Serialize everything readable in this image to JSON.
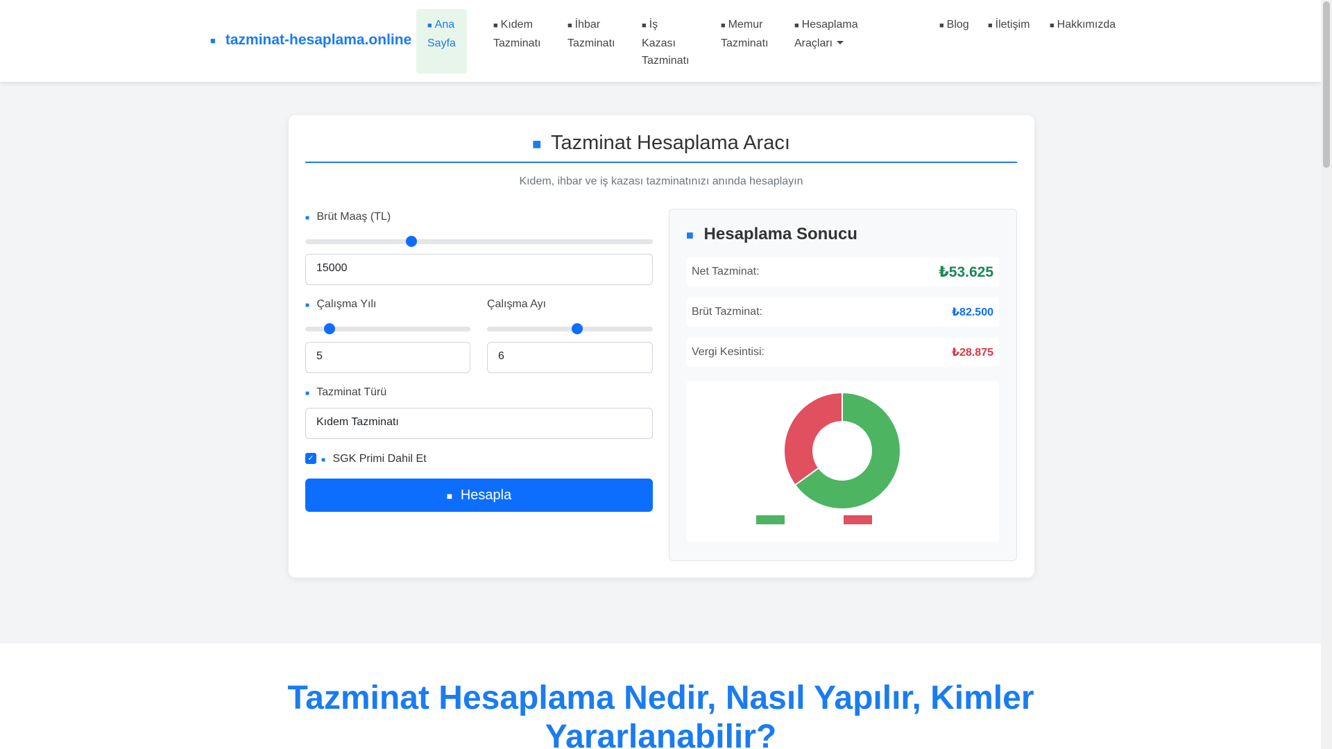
{
  "nav": {
    "brand": "tazminat-hesaplama.online",
    "items": [
      {
        "label_lines": [
          "Ana",
          "Sayfa"
        ],
        "icon": "home-icon",
        "active": true
      },
      {
        "label_lines": [
          "Kıdem",
          "Tazminatı"
        ],
        "icon": "briefcase-icon",
        "active": false
      },
      {
        "label_lines": [
          "İhbar",
          "Tazminatı"
        ],
        "icon": "bell-icon",
        "active": false
      },
      {
        "label_lines": [
          "İş",
          "Kazası",
          "Tazminatı"
        ],
        "icon": "hard-hat-icon",
        "active": false
      },
      {
        "label_lines": [
          "Memur",
          "Tazminatı"
        ],
        "icon": "user-tie-icon",
        "active": false
      },
      {
        "label_lines": [
          "Hesaplama Araçları"
        ],
        "icon": "calculator-icon",
        "active": false
      },
      {
        "label_lines": [
          "Blog"
        ],
        "icon": "blog-icon",
        "active": false
      },
      {
        "label_lines": [
          "İletişim"
        ],
        "icon": "envelope-icon",
        "active": false
      },
      {
        "label_lines": [
          "Hakkımızda"
        ],
        "icon": "info-icon",
        "active": false
      }
    ]
  },
  "calculator": {
    "title": "Tazminat Hesaplama Aracı",
    "subtitle": "Kıdem, ihbar ve iş kazası tazminatınızı anında hesaplayın",
    "salary": {
      "label": "Brüt Maaş (TL)",
      "value": "15000",
      "slider_fraction": 0.305
    },
    "years": {
      "label": "Çalışma Yılı",
      "value": "5",
      "slider_fraction": 0.147
    },
    "months": {
      "label": "Çalışma Ayı",
      "value": "6",
      "slider_fraction": 0.545
    },
    "type": {
      "label": "Tazminat Türü",
      "value": "Kıdem Tazminatı"
    },
    "sgk": {
      "label": "SGK Primi Dahil Et",
      "checked": true
    },
    "button": "Hesapla"
  },
  "result": {
    "title": "Hesaplama Sonucu",
    "rows": [
      {
        "label": "Net Tazminat:",
        "value": "₺53.625",
        "color": "#198754"
      },
      {
        "label": "Brüt Tazminat:",
        "value": "₺82.500",
        "color": "#0d6efd"
      },
      {
        "label": "Vergi Kesintisi:",
        "value": "₺28.875",
        "color": "#dc3545"
      }
    ]
  },
  "chart_data": {
    "type": "pie",
    "values": [
      53625,
      28875
    ],
    "colors": [
      "#4db462",
      "#e0505f"
    ]
  },
  "section": {
    "heading": "Tazminat Hesaplama Nedir, Nasıl Yapılır, Kimler Yararlanabilir?"
  }
}
